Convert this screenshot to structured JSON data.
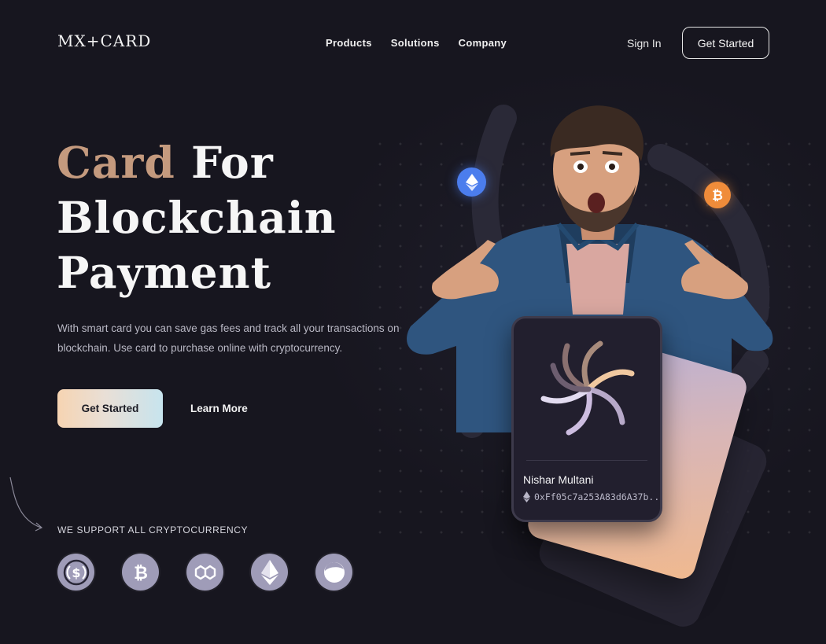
{
  "brand": {
    "logo": "MX+CARD"
  },
  "nav": {
    "items": [
      {
        "label": "Products"
      },
      {
        "label": "Solutions"
      },
      {
        "label": "Company"
      }
    ],
    "sign_in": "Sign In",
    "get_started": "Get Started"
  },
  "hero": {
    "title_accent": "Card",
    "title_rest_1": "For",
    "title_line_2": "Blockchain",
    "title_line_3": "Payment",
    "description": "With smart card you can save gas fees and track all your transactions on blockchain. Use card to purchase online with cryptocurrency.",
    "primary_button": "Get Started",
    "secondary_button": "Learn More"
  },
  "support": {
    "label": "WE SUPPORT ALL CRYPTOCURRENCY",
    "coins": [
      {
        "icon": "usdc-icon"
      },
      {
        "icon": "bitcoin-icon"
      },
      {
        "icon": "polygon-icon"
      },
      {
        "icon": "ethereum-icon"
      },
      {
        "icon": "terra-icon"
      }
    ]
  },
  "card": {
    "holder_name": "Nishar Multani",
    "address": "0xFf05c7a253A83d6A37b..."
  },
  "colors": {
    "background": "#17161f",
    "accent": "#c49a7e",
    "coin": "#9f9cb8",
    "eth_badge": "#4b7ded",
    "btc_badge": "#f08c3a"
  }
}
